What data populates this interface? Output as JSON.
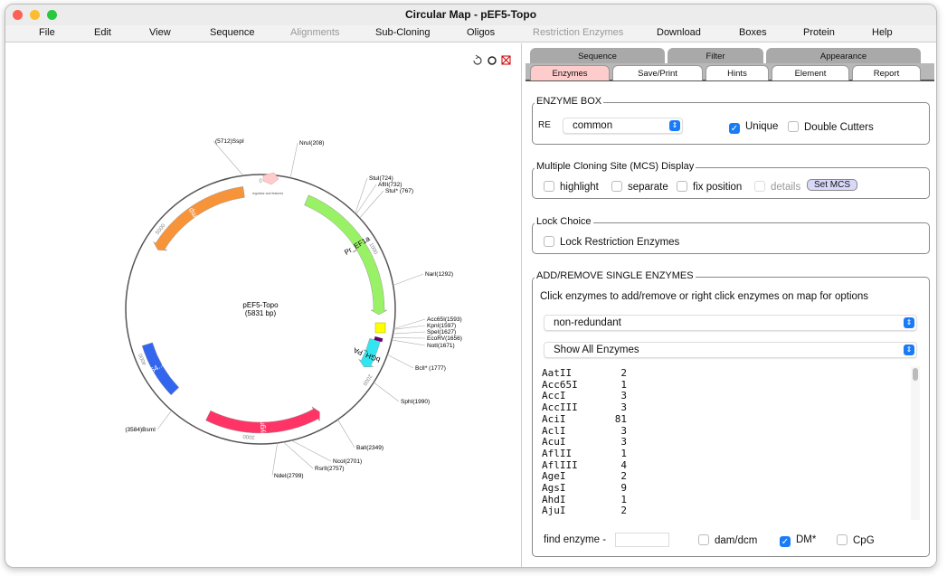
{
  "window": {
    "title": "Circular Map - pEF5-Topo"
  },
  "menu": [
    "File",
    "Edit",
    "View",
    "Sequence",
    "Alignments",
    "Sub-Cloning",
    "Oligos",
    "Restriction Enzymes",
    "Download",
    "Boxes",
    "Protein",
    "Help"
  ],
  "menu_disabled": [
    "Alignments",
    "Restriction Enzymes"
  ],
  "map": {
    "name": "pEF5-Topo",
    "size_label": "(5831 bp)",
    "length": 5831,
    "ticks": [
      "0",
      "1000",
      "2000",
      "3000",
      "4000",
      "5000"
    ],
    "features": [
      {
        "label": "amp",
        "start": 4860,
        "end": 5700,
        "dir": -1,
        "color": "#f7943a"
      },
      {
        "label": "Pr_EF1a",
        "start": 370,
        "end": 1500,
        "dir": 1,
        "color": "#99f266"
      },
      {
        "label": "bGH_PA",
        "start": 1700,
        "end": 1930,
        "dir": 1,
        "color": "#33e5ee"
      },
      {
        "label": "hygroB",
        "start": 2430,
        "end": 3340,
        "dir": -1,
        "color": "#ff3366"
      },
      {
        "label": "3664..4095",
        "start": 3664,
        "end": 4095,
        "dir": 0,
        "color": "#3366ee"
      }
    ],
    "small_feature_label": "regulator and features",
    "enzymes": [
      {
        "label": "(5712)SspI",
        "pos": 5712
      },
      {
        "label": "NruI(208)",
        "pos": 208
      },
      {
        "label": "StuI(724)",
        "pos": 724
      },
      {
        "label": "AflII(732)",
        "pos": 732
      },
      {
        "label": "StuI* (767)",
        "pos": 767
      },
      {
        "label": "NarI(1292)",
        "pos": 1292
      },
      {
        "label": "Acc65I(1593)",
        "pos": 1593
      },
      {
        "label": "KpnI(1597)",
        "pos": 1597
      },
      {
        "label": "SpeI(1627)",
        "pos": 1627
      },
      {
        "label": "EcoRV(1656)",
        "pos": 1656
      },
      {
        "label": "NotI(1671)",
        "pos": 1671
      },
      {
        "label": "BclI* (1777)",
        "pos": 1777
      },
      {
        "label": "SphI(1990)",
        "pos": 1990
      },
      {
        "label": "BalI(2349)",
        "pos": 2349
      },
      {
        "label": "NcoI(2701)",
        "pos": 2701
      },
      {
        "label": "RsrII(2757)",
        "pos": 2757
      },
      {
        "label": "NdeI(2799)",
        "pos": 2799
      },
      {
        "label": "(3584)BsmI",
        "pos": 3584
      }
    ]
  },
  "tabs": {
    "row1": [
      "Sequence",
      "Filter",
      "Appearance"
    ],
    "row2": [
      "Enzymes",
      "Save/Print",
      "Hints",
      "Element",
      "Report"
    ],
    "active": "Enzymes"
  },
  "enzyme_box": {
    "title": "ENZYME BOX",
    "re_icon": "RE",
    "set": "common",
    "unique": "Unique",
    "unique_checked": true,
    "double": "Double Cutters",
    "double_checked": false
  },
  "mcs": {
    "title": "Multiple Cloning Site (MCS) Display",
    "highlight": "highlight",
    "separate": "separate",
    "fix": "fix position",
    "details": "details",
    "set_button": "Set MCS"
  },
  "lock": {
    "title": "Lock Choice",
    "label": "Lock Restriction Enzymes"
  },
  "addremove": {
    "title": "ADD/REMOVE SINGLE ENZYMES",
    "hint": "Click enzymes to add/remove or right click enzymes on map for options",
    "select1": "non-redundant",
    "select2": "Show All Enzymes",
    "enzymes": [
      [
        "AatII",
        "2"
      ],
      [
        "Acc65I",
        "1"
      ],
      [
        "AccI",
        "3"
      ],
      [
        "AccIII",
        "3"
      ],
      [
        "AciI",
        "81"
      ],
      [
        "AclI",
        "3"
      ],
      [
        "AcuI",
        "3"
      ],
      [
        "AflII",
        "1"
      ],
      [
        "AflIII",
        "4"
      ],
      [
        "AgeI",
        "2"
      ],
      [
        "AgsI",
        "9"
      ],
      [
        "AhdI",
        "1"
      ],
      [
        "AjuI",
        "2"
      ]
    ],
    "find_label": "find enzyme -",
    "find_value": "",
    "dam": "dam/dcm",
    "dam_checked": false,
    "dm": "DM*",
    "dm_checked": true,
    "cpg": "CpG",
    "cpg_checked": false
  }
}
